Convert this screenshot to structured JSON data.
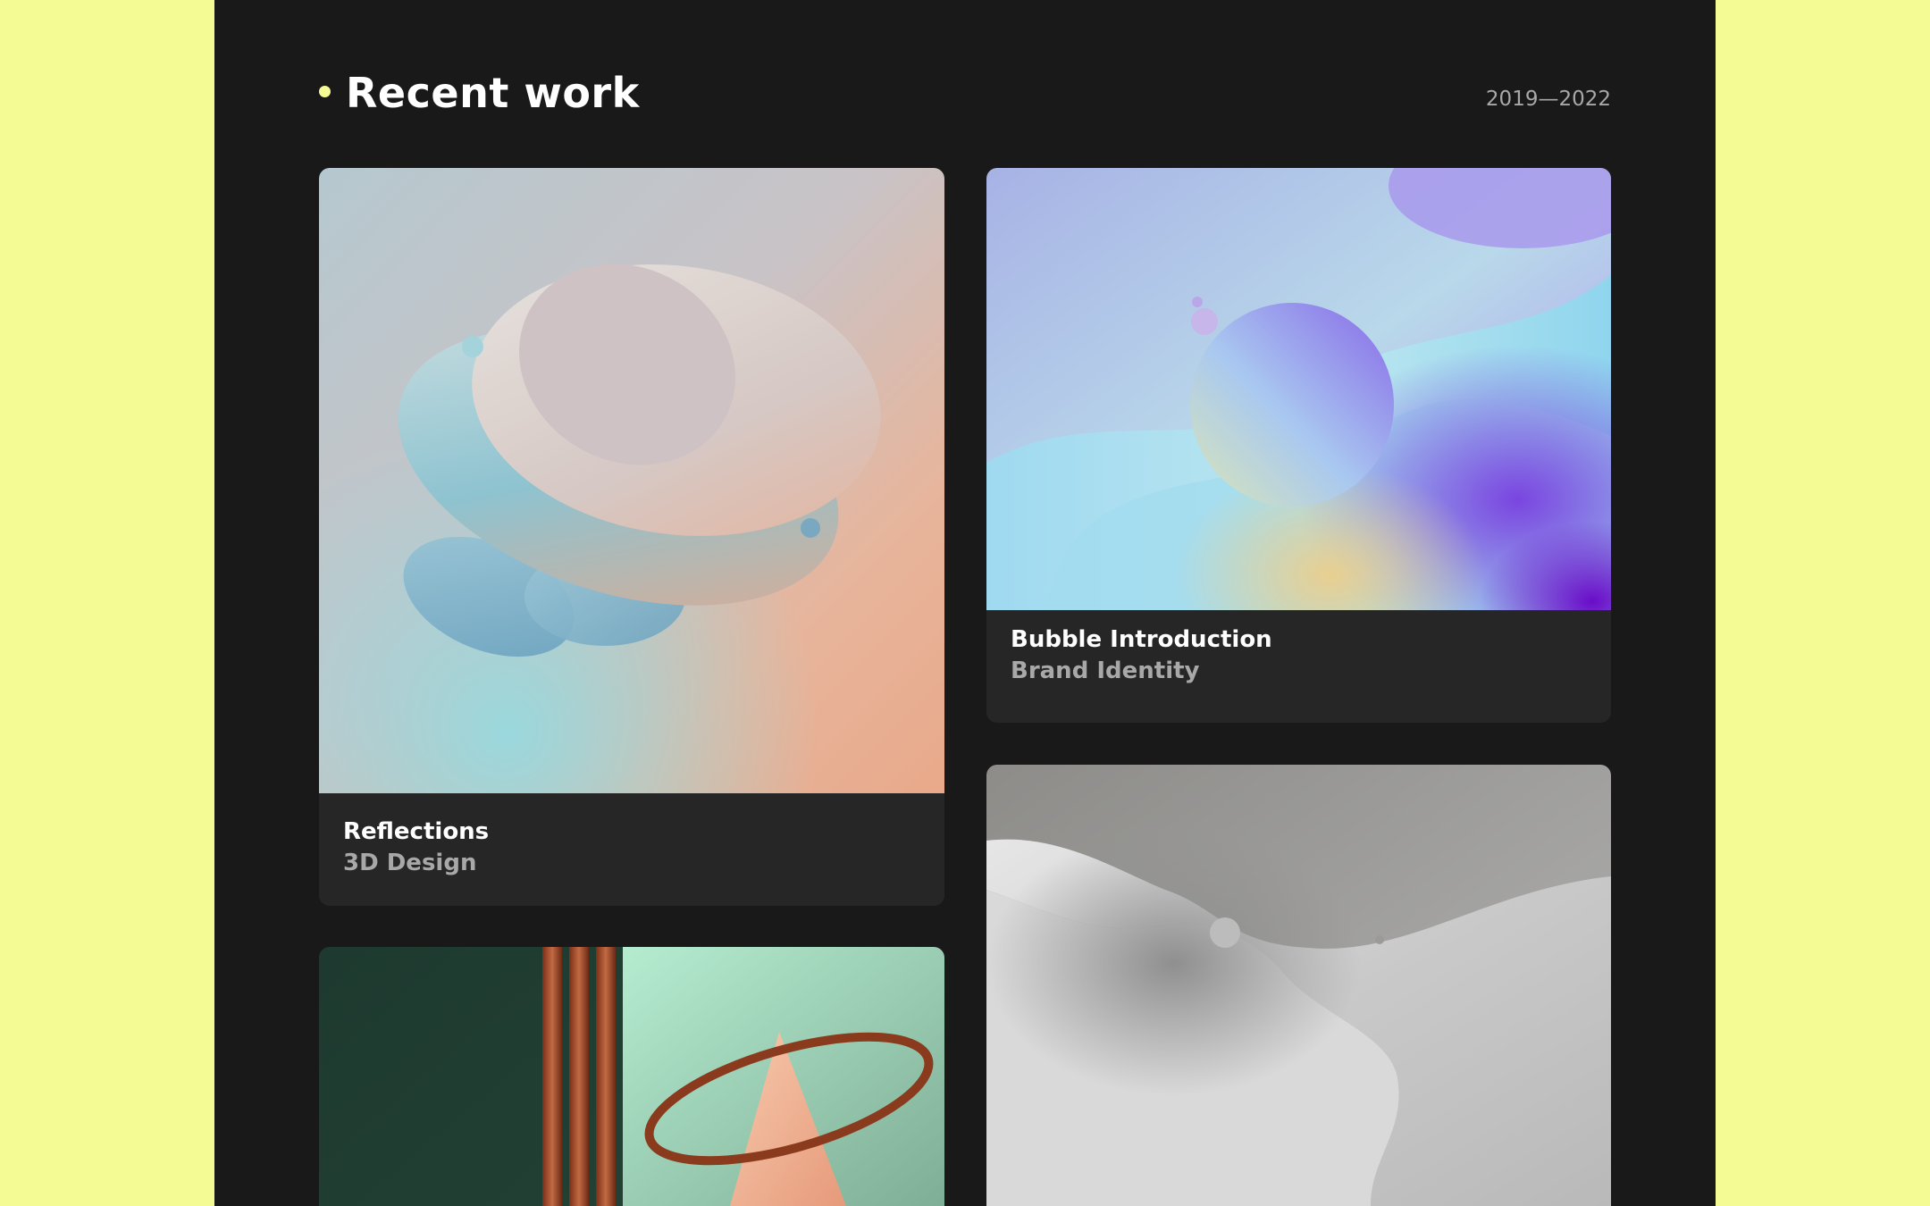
{
  "colors": {
    "backdrop": "#f4fb94",
    "panel": "#191919",
    "caption_bg": "#262626",
    "accent_dot": "#f4fb94",
    "title": "#ffffff",
    "muted": "#a8a8a8"
  },
  "header": {
    "bullet_icon": "dot-icon",
    "title": "Recent work",
    "date_range": "2019—2022"
  },
  "projects": [
    {
      "title": "Reflections",
      "category": "3D Design",
      "artwork": "layered-pastel-discs"
    },
    {
      "title": "Bubble Introduction",
      "category": "Brand Identity",
      "artwork": "iridescent-sphere"
    },
    {
      "title": "",
      "category": "",
      "artwork": "copper-ring-and-cone"
    },
    {
      "title": "",
      "category": "",
      "artwork": "grey-fluid-landscape"
    }
  ]
}
